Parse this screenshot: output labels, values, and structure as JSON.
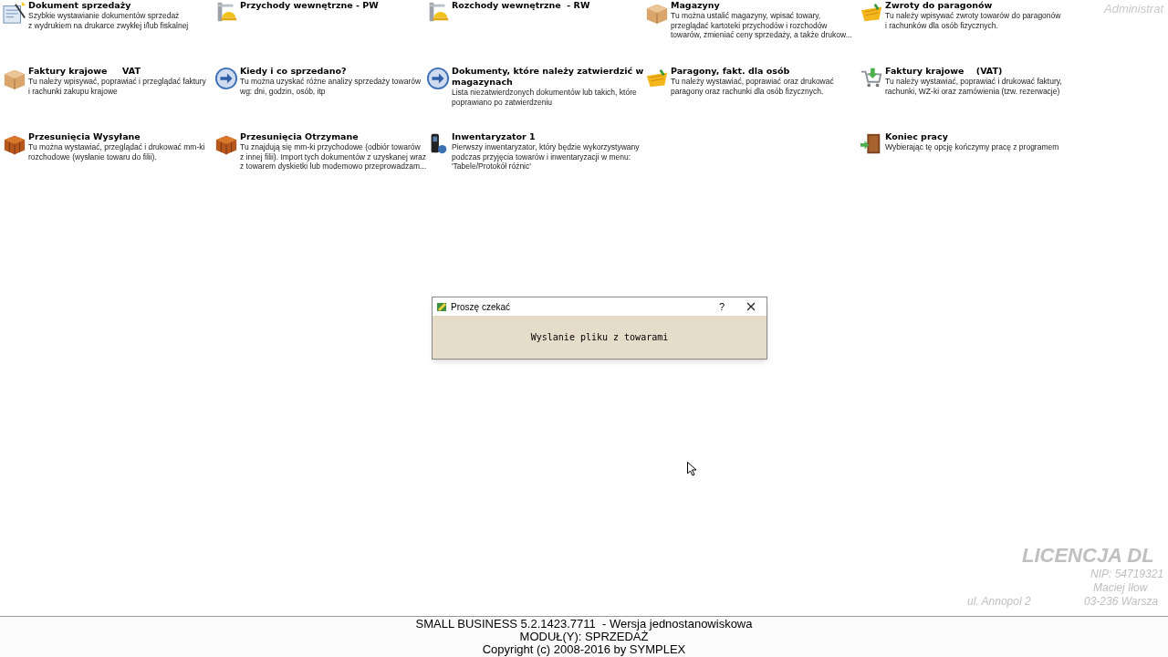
{
  "columns": [
    {
      "tiles": [
        {
          "kind": "document",
          "title": "Dokument sprzedaży",
          "description": "Szybkie wystawianie dokumentów sprzedaż\nz wydrukiem na drukarce zwykłej i/lub fiskalnej"
        },
        {
          "kind": "carton",
          "title": "Faktury krajowe     VAT",
          "description": "Tu należy wpisywać, poprawiać i przeglądać faktury\ni rachunki zakupu krajowe"
        },
        {
          "kind": "crate",
          "title": "Przesunięcia Wysyłane",
          "description": "Tu można wystawiać, przeglądać i drukować mm-ki\nrozchodowe (wysłanie towaru do filii)."
        }
      ]
    },
    {
      "tiles": [
        {
          "kind": "crane",
          "title": "Przychody wewnętrzne - PW"
        },
        {
          "kind": "arrow",
          "title": "Kiedy i co sprzedano?",
          "description": "Tu można uzyskać różne analizy sprzedaży towarów\nwg: dni, godzin, osób, itp"
        },
        {
          "kind": "crate",
          "title": "Przesunięcia Otrzymane",
          "description": "Tu znajdują się mm-ki przychodowe (odbiór towarów\nz innej filii). Import tych dokumentów z uzyskanej wraz\nz towarem dyskietki lub modemowo przeprowadzam..."
        }
      ]
    },
    {
      "tiles": [
        {
          "kind": "crane",
          "title": "Rozchody wewnętrzne  - RW"
        },
        {
          "kind": "arrow",
          "title": "Dokumenty, które należy zatwierdzić w magazynach",
          "description": "Lista niezatwierdzonych dokumentów lub takich, które\npoprawiano po zatwierdzeniu"
        },
        {
          "kind": "device",
          "title": "Inwentaryzator 1",
          "description": "Pierwszy inwentaryzator, który będzie wykorzystywany\npodczas przyjęcia towarów i inwentaryzacji w menu:\n'Tabele/Protokół różnic'"
        }
      ]
    },
    {
      "tiles": [
        {
          "kind": "carton",
          "title": "Magazyny",
          "description": "Tu można ustalić magazyny, wpisać towary,\nprzeglądać kartoteki przychodów i rozchodów\ntowarów, zmieniać ceny sprzedaży, a także drukow..."
        },
        {
          "kind": "basket",
          "title": "Paragony, fakt. dla osób",
          "description": "Tu należy wystawiać, poprawiać oraz drukować\nparagony oraz rachunki dla osób fizycznych."
        }
      ]
    },
    {
      "tiles": [
        {
          "kind": "basket",
          "title": "Zwroty do paragonów",
          "description": "Tu należy wpisywać zwroty towarów do paragonów\ni rachunków dla osób fizycznych."
        },
        {
          "kind": "cart",
          "title": "Faktury krajowe    (VAT)",
          "description": "Tu należy wystawiać, poprawiać i drukować faktury,\nrachunki, WZ-ki oraz zamówienia (tzw. rezerwacje)"
        },
        {
          "kind": "door",
          "title": "Koniec pracy",
          "description": "Wybierając tę opcję kończymy pracę z programem"
        }
      ]
    }
  ],
  "user": "Administrat",
  "license": {
    "title": "LICENCJA DL",
    "nip": "NIP: 54719321",
    "name": "Maciej Iłow",
    "street": "ul. Annopol 2",
    "city": "03-236 Warsza"
  },
  "dialog": {
    "title": "Proszę czekać",
    "help": "?",
    "message": "Wyslanie pliku z towarami"
  },
  "footer": [
    "SMALL BUSINESS 5.2.1423.7711  - Wersja jednostanowiskowa",
    "MODUŁ(Y): SPRZEDAŻ",
    "Copyright (c) 2008-2016 by SYMPLEX"
  ]
}
